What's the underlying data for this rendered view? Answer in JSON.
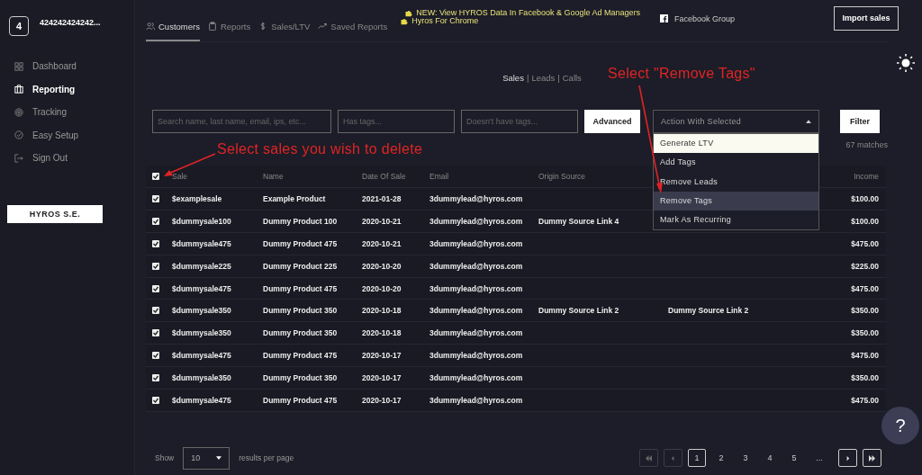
{
  "sidebar": {
    "account_number": "4",
    "account_name": "424242424242...",
    "items": [
      {
        "label": "Dashboard",
        "selected": false
      },
      {
        "label": "Reporting",
        "selected": true
      },
      {
        "label": "Tracking",
        "selected": false
      },
      {
        "label": "Easy Setup",
        "selected": false
      },
      {
        "label": "Sign Out",
        "selected": false
      }
    ],
    "brand_button": "HYROS S.E."
  },
  "tabs": [
    {
      "label": "Customers",
      "selected": true
    },
    {
      "label": "Reports",
      "selected": false
    },
    {
      "label": "Sales/LTV",
      "selected": false
    },
    {
      "label": "Saved Reports",
      "selected": false
    }
  ],
  "announcements": [
    "NEW: View HYROS Data In Facebook & Google Ad Managers",
    "Hyros For Chrome"
  ],
  "facebook_link": "Facebook Group",
  "import_button": "Import sales",
  "views": [
    {
      "label": "Sales",
      "selected": true
    },
    {
      "label": "Leads",
      "selected": false
    },
    {
      "label": "Calls",
      "selected": false
    }
  ],
  "view_separators": [
    "|",
    "|"
  ],
  "filters": {
    "search": {
      "placeholder": "Search name, last name, email, ips, etc..."
    },
    "has_tags": {
      "placeholder": "Has tags..."
    },
    "no_tags": {
      "placeholder": "Doesn't have tags..."
    },
    "advanced_button": "Advanced",
    "action_select": {
      "placeholder": "Action With Selected",
      "expanded": true,
      "options": [
        {
          "label": "Generate LTV",
          "selected": true,
          "hovered": false
        },
        {
          "label": "Add Tags",
          "selected": false,
          "hovered": false
        },
        {
          "label": "Remove Leads",
          "selected": false,
          "hovered": false
        },
        {
          "label": "Remove Tags",
          "selected": false,
          "hovered": true
        },
        {
          "label": "Mark As Recurring",
          "selected": false,
          "hovered": false
        }
      ]
    },
    "filter_button": "Filter"
  },
  "match_count": "67 matches",
  "annotations": [
    {
      "text": "Select sales you wish to delete"
    },
    {
      "text": "Select \"Remove Tags\""
    }
  ],
  "table": {
    "all_checked": true,
    "columns": [
      "Sale",
      "Name",
      "Date Of Sale",
      "Email",
      "Origin Source",
      "",
      "Income"
    ],
    "rows": [
      {
        "checked": true,
        "cells": [
          "$examplesale",
          "Example Product",
          "2021-01-28",
          "3dummylead@hyros.com",
          "",
          "",
          "$100.00"
        ]
      },
      {
        "checked": true,
        "cells": [
          "$dummysale100",
          "Dummy Product 100",
          "2020-10-21",
          "3dummylead@hyros.com",
          "Dummy Source Link 4",
          "",
          "$100.00"
        ]
      },
      {
        "checked": true,
        "cells": [
          "$dummysale475",
          "Dummy Product 475",
          "2020-10-21",
          "3dummylead@hyros.com",
          "",
          "",
          "$475.00"
        ]
      },
      {
        "checked": true,
        "cells": [
          "$dummysale225",
          "Dummy Product 225",
          "2020-10-20",
          "3dummylead@hyros.com",
          "",
          "",
          "$225.00"
        ]
      },
      {
        "checked": true,
        "cells": [
          "$dummysale475",
          "Dummy Product 475",
          "2020-10-20",
          "3dummylead@hyros.com",
          "",
          "",
          "$475.00"
        ]
      },
      {
        "checked": true,
        "cells": [
          "$dummysale350",
          "Dummy Product 350",
          "2020-10-18",
          "3dummylead@hyros.com",
          "Dummy Source Link 2",
          "Dummy Source Link 2",
          "$350.00"
        ]
      },
      {
        "checked": true,
        "cells": [
          "$dummysale350",
          "Dummy Product 350",
          "2020-10-18",
          "3dummylead@hyros.com",
          "",
          "",
          "$350.00"
        ]
      },
      {
        "checked": true,
        "cells": [
          "$dummysale475",
          "Dummy Product 475",
          "2020-10-17",
          "3dummylead@hyros.com",
          "",
          "",
          "$475.00"
        ]
      },
      {
        "checked": true,
        "cells": [
          "$dummysale350",
          "Dummy Product 350",
          "2020-10-17",
          "3dummylead@hyros.com",
          "",
          "",
          "$350.00"
        ]
      },
      {
        "checked": true,
        "cells": [
          "$dummysale475",
          "Dummy Product 475",
          "2020-10-17",
          "3dummylead@hyros.com",
          "",
          "",
          "$475.00"
        ]
      }
    ]
  },
  "help_button": "?",
  "pagination": {
    "show_label": "Show",
    "page_size": "10",
    "per_page_label": "results per page",
    "pages": [
      {
        "label": "1",
        "selected": true
      },
      {
        "label": "2",
        "selected": false
      },
      {
        "label": "3",
        "selected": false
      },
      {
        "label": "4",
        "selected": false
      },
      {
        "label": "5",
        "selected": false
      }
    ],
    "ellipsis": "..."
  }
}
